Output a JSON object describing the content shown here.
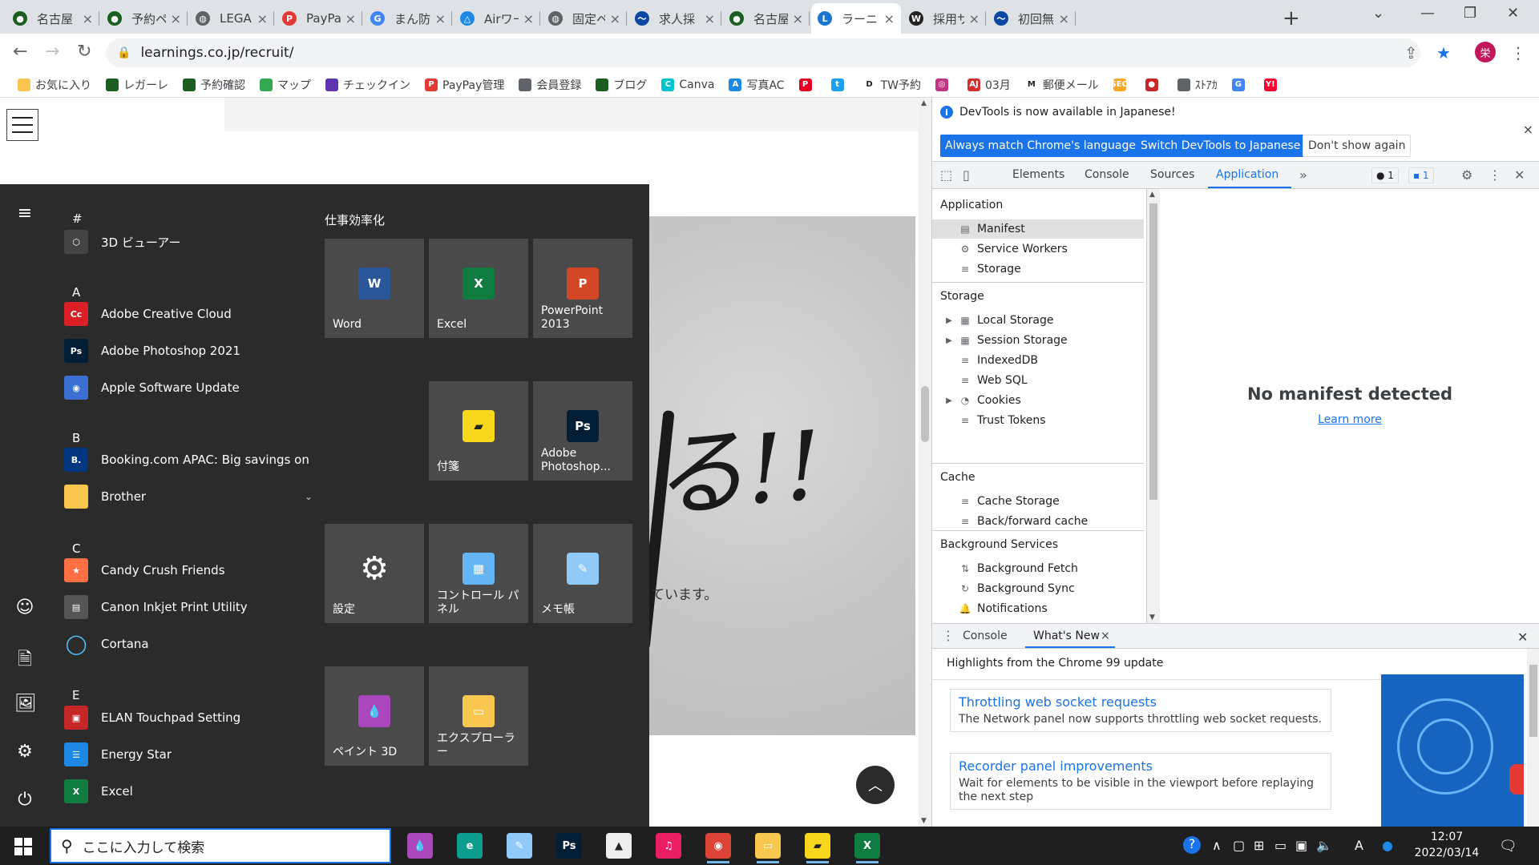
{
  "browser": {
    "tabs": [
      {
        "title": "名古屋",
        "color": "#1b5e20",
        "glyph": "●"
      },
      {
        "title": "予約ペ",
        "color": "#1b5e20",
        "glyph": "●"
      },
      {
        "title": "LEGARE",
        "color": "#5f6368",
        "glyph": "◍"
      },
      {
        "title": "PayPay",
        "color": "#e53935",
        "glyph": "P"
      },
      {
        "title": "まん防",
        "color": "#4285f4",
        "glyph": "G"
      },
      {
        "title": "Airワーク",
        "color": "#1e88e5",
        "glyph": "△"
      },
      {
        "title": "固定ペ",
        "color": "#5f6368",
        "glyph": "◍"
      },
      {
        "title": "求人採",
        "color": "#0d47a1",
        "glyph": "〜"
      },
      {
        "title": "名古屋",
        "color": "#1b5e20",
        "glyph": "●"
      },
      {
        "title": "ラーニング",
        "color": "#1976d2",
        "glyph": "L",
        "active": true
      },
      {
        "title": "採用サ",
        "color": "#222222",
        "glyph": "W"
      },
      {
        "title": "初回無",
        "color": "#0d47a1",
        "glyph": "〜"
      }
    ],
    "close_glyph": "×",
    "new_tab_glyph": "+",
    "window_controls": {
      "dropdown": "⌄",
      "minimize": "—",
      "restore": "❐",
      "close": "✕"
    },
    "nav": {
      "back": "←",
      "forward": "→",
      "reload": "↻"
    },
    "url": "learnings.co.jp/recruit/",
    "profile_initial": "栄",
    "omni_icons": {
      "share": "⇪",
      "star": "★",
      "menu": "⋮"
    },
    "bookmarks": [
      {
        "label": "お気に入り",
        "color": "#f9c74f",
        "glyph": ""
      },
      {
        "label": "レガーレ",
        "color": "#1b5e20",
        "glyph": ""
      },
      {
        "label": "予約確認",
        "color": "#1b5e20",
        "glyph": ""
      },
      {
        "label": "マップ",
        "color": "#34a853",
        "glyph": ""
      },
      {
        "label": "チェックイン",
        "color": "#5e35b1",
        "glyph": ""
      },
      {
        "label": "PayPay管理",
        "color": "#e53935",
        "glyph": "P"
      },
      {
        "label": "会員登録",
        "color": "#5f6368",
        "glyph": ""
      },
      {
        "label": "ブログ",
        "color": "#1b5e20",
        "glyph": ""
      },
      {
        "label": "Canva",
        "color": "#00c4cc",
        "glyph": "C"
      },
      {
        "label": "写真AC",
        "color": "#1e88e5",
        "glyph": "A"
      },
      {
        "label": "",
        "color": "#e60023",
        "glyph": "P"
      },
      {
        "label": "",
        "color": "#1da1f2",
        "glyph": "t"
      },
      {
        "label": "TW予約",
        "color": "#ffffff",
        "glyph": "D"
      },
      {
        "label": "",
        "color": "#c13584",
        "glyph": "◎"
      },
      {
        "label": "03月",
        "color": "#d32f2f",
        "glyph": "AJ"
      },
      {
        "label": "郵便メール",
        "color": "#ffffff",
        "glyph": "M"
      },
      {
        "label": "",
        "color": "#f9a825",
        "glyph": "SEO"
      },
      {
        "label": "",
        "color": "#c62828",
        "glyph": "●"
      },
      {
        "label": "ｽﾄｱｶ",
        "color": "#5f6368",
        "glyph": ""
      },
      {
        "label": "",
        "color": "#4285f4",
        "glyph": "G"
      },
      {
        "label": "",
        "color": "#ff0033",
        "glyph": "Y!"
      }
    ]
  },
  "webpage": {
    "hero_text": "る!!",
    "hero_sub": "ています。",
    "to_top": "︿"
  },
  "startmenu": {
    "rail_icons": [
      "≡",
      "☺",
      "🗎",
      "🖼",
      "⚙",
      "⏻"
    ],
    "letters": [
      "#",
      "A",
      "B",
      "C",
      "E"
    ],
    "apps": [
      {
        "label": "3D ビューアー",
        "color": "#444",
        "glyph": "⬡"
      },
      {
        "label": "Adobe Creative Cloud",
        "color": "#da1f26",
        "glyph": "Cc"
      },
      {
        "label": "Adobe Photoshop 2021",
        "color": "#001e36",
        "glyph": "Ps"
      },
      {
        "label": "Apple Software Update",
        "color": "#3b6fd1",
        "glyph": "◉"
      },
      {
        "label": "Booking.com APAC: Big savings on ho...",
        "color": "#003580",
        "glyph": "B."
      },
      {
        "label": "Brother",
        "color": "#f9c74f",
        "glyph": "",
        "chevron": "⌄"
      },
      {
        "label": "Candy Crush Friends",
        "color": "#ff7043",
        "glyph": "★"
      },
      {
        "label": "Canon Inkjet Print Utility",
        "color": "#555",
        "glyph": "▤"
      },
      {
        "label": "Cortana",
        "color": "transparent",
        "glyph": "◯"
      },
      {
        "label": "ELAN Touchpad Setting",
        "color": "#c62828",
        "glyph": "▣"
      },
      {
        "label": "Energy Star",
        "color": "#1e88e5",
        "glyph": "☰"
      },
      {
        "label": "Excel",
        "color": "#107c41",
        "glyph": "X"
      }
    ],
    "group_title": "仕事効率化",
    "tiles": [
      {
        "label": "Word",
        "color": "#2b579a",
        "glyph": "W"
      },
      {
        "label": "Excel",
        "color": "#107c41",
        "glyph": "X"
      },
      {
        "label": "PowerPoint 2013",
        "color": "#d24726",
        "glyph": "P"
      },
      {
        "label": "付箋",
        "color": "#f9d71c",
        "glyph": "▰"
      },
      {
        "label": "Adobe Photoshop...",
        "color": "#001e36",
        "glyph": "Ps"
      },
      {
        "label": "設定",
        "color": "transparent",
        "glyph": "⚙"
      },
      {
        "label": "コントロール パネル",
        "color": "#64b5f6",
        "glyph": "▦"
      },
      {
        "label": "メモ帳",
        "color": "#90caf9",
        "glyph": "✎"
      },
      {
        "label": "ペイント 3D",
        "color": "#ab47bc",
        "glyph": "💧"
      },
      {
        "label": "エクスプローラー",
        "color": "#f9c74f",
        "glyph": "▭"
      }
    ]
  },
  "devtools": {
    "info_text": "DevTools is now available in Japanese!",
    "info_glyph": "i",
    "btn_match": "Always match Chrome's language",
    "btn_switch": "Switch DevTools to Japanese",
    "btn_dont": "Don't show again",
    "close_glyph": "×",
    "tabs": [
      "Elements",
      "Console",
      "Sources",
      "Application"
    ],
    "more_glyph": "»",
    "badge_errors": "● 1",
    "badge_issues": "▪ 1",
    "tool_icons": {
      "inspect": "⬚",
      "device": "▯",
      "gear": "⚙",
      "kebab": "⋮",
      "close": "✕"
    },
    "sections": {
      "application": "Application",
      "storage": "Storage",
      "cache": "Cache",
      "background": "Background Services"
    },
    "app_items": [
      {
        "label": "Manifest",
        "icon": "▤",
        "selected": true
      },
      {
        "label": "Service Workers",
        "icon": "⚙"
      },
      {
        "label": "Storage",
        "icon": "≡"
      }
    ],
    "storage_items": [
      {
        "label": "Local Storage",
        "icon": "▦",
        "expand": "▶"
      },
      {
        "label": "Session Storage",
        "icon": "▦",
        "expand": "▶"
      },
      {
        "label": "IndexedDB",
        "icon": "≡"
      },
      {
        "label": "Web SQL",
        "icon": "≡"
      },
      {
        "label": "Cookies",
        "icon": "◔",
        "expand": "▶"
      },
      {
        "label": "Trust Tokens",
        "icon": "≡"
      }
    ],
    "cache_items": [
      {
        "label": "Cache Storage",
        "icon": "≡"
      },
      {
        "label": "Back/forward cache",
        "icon": "≡"
      }
    ],
    "bg_items": [
      {
        "label": "Background Fetch",
        "icon": "⇅"
      },
      {
        "label": "Background Sync",
        "icon": "↻"
      },
      {
        "label": "Notifications",
        "icon": "🔔"
      }
    ],
    "no_manifest": "No manifest detected",
    "learn_more": "Learn more",
    "drawer_tabs": [
      "Console",
      "What's New"
    ],
    "drawer_kebab": "⋮",
    "highlights": "Highlights from the Chrome 99 update",
    "cards": [
      {
        "title": "Throttling web socket requests",
        "desc": "The Network panel now supports throttling web socket requests."
      },
      {
        "title": "Recorder panel improvements",
        "desc": "Wait for elements to be visible in the viewport before replaying the next step"
      }
    ],
    "play_glyph": "▶",
    "scroll_up": "▲",
    "scroll_down": "▼"
  },
  "taskbar": {
    "search_placeholder": "ここに入力して検索",
    "search_glyph": "⚲",
    "apps": [
      {
        "name": "paint3d",
        "color": "#ab47bc",
        "glyph": "💧"
      },
      {
        "name": "edge",
        "color": "#0c9d8f",
        "glyph": "e"
      },
      {
        "name": "notepad",
        "color": "#90caf9",
        "glyph": "✎"
      },
      {
        "name": "photoshop",
        "color": "#001e36",
        "glyph": "Ps"
      },
      {
        "name": "app-penguin",
        "color": "#eeeeee",
        "glyph": "▲"
      },
      {
        "name": "itunes",
        "color": "#e91e63",
        "glyph": "♫"
      },
      {
        "name": "chrome",
        "color": "#db4437",
        "glyph": "◉"
      },
      {
        "name": "explorer",
        "color": "#f9c74f",
        "glyph": "▭"
      },
      {
        "name": "sticky-notes",
        "color": "#f9d71c",
        "glyph": "▰"
      },
      {
        "name": "excel",
        "color": "#107c41",
        "glyph": "X"
      }
    ],
    "tray": [
      "?",
      "∧",
      "▢",
      "⊞",
      "▭",
      "▣",
      "🔈",
      "A",
      "●"
    ],
    "time": "12:07",
    "date": "2022/03/14",
    "notif_glyph": "🗨"
  }
}
